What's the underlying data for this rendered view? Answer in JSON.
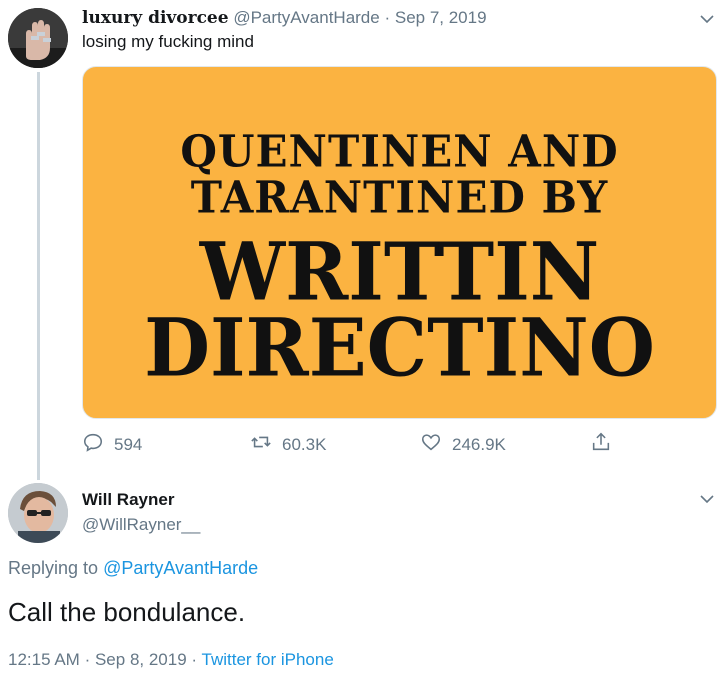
{
  "tweet": {
    "display_name": "luxury divorcee",
    "handle": "@PartyAvantHarde",
    "separator": "·",
    "date": "Sep 7, 2019",
    "text": "losing my fucking mind",
    "media": {
      "lines": [
        "QUENTINEN AND",
        "TARANTINED BY",
        "WRITTIN",
        "DIRECTINO"
      ],
      "background": "#fbb341"
    },
    "actions": {
      "replies": "594",
      "retweets": "60.3K",
      "likes": "246.9K"
    }
  },
  "reply": {
    "display_name": "Will Rayner",
    "handle": "@WillRayner__",
    "replying_prefix": "Replying to",
    "replying_to": "@PartyAvantHarde",
    "text": "Call the bondulance.",
    "time": "12:15 AM",
    "separator": "·",
    "date": "Sep 8, 2019",
    "source": "Twitter for iPhone"
  },
  "colors": {
    "link": "#1b95e0",
    "muted": "#657786",
    "thread_line": "#ccd6dd"
  },
  "icons": [
    "chevron-down-icon",
    "reply-icon",
    "retweet-icon",
    "like-icon",
    "share-icon"
  ]
}
